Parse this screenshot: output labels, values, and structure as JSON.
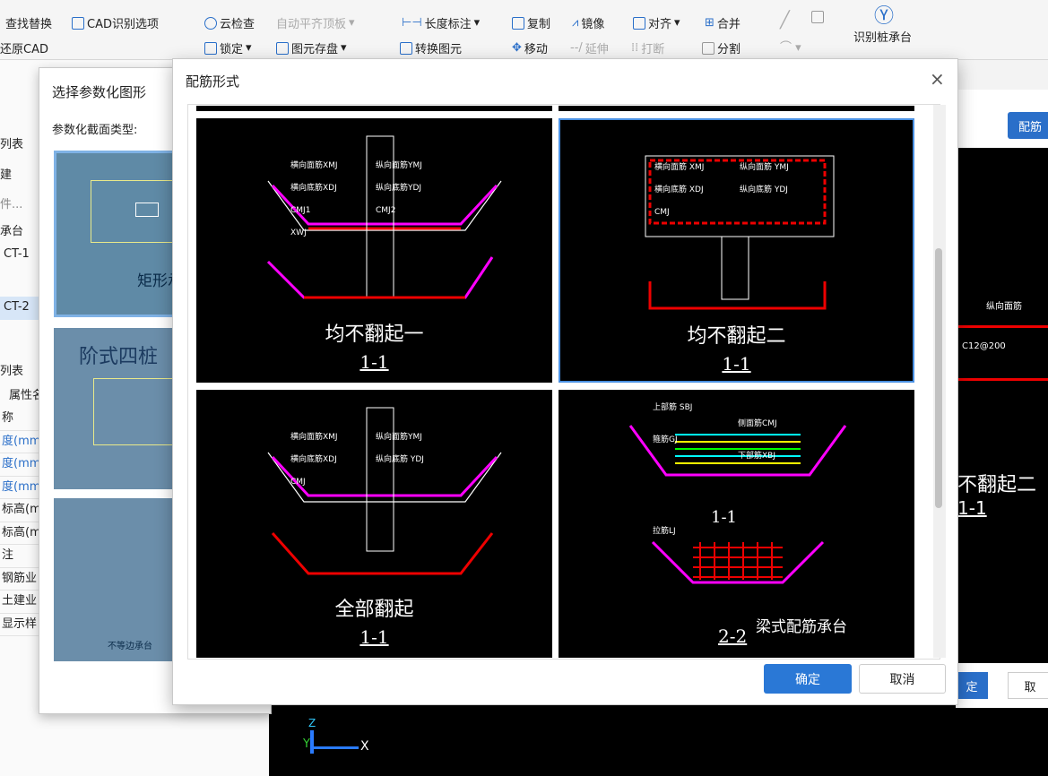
{
  "ribbon": {
    "find_replace": "查找替换",
    "cad_options": "CAD识别选项",
    "restore_cad": "还原CAD",
    "cloud_check": "云检查",
    "auto_align": "自动平齐顶板",
    "dim_length": "长度标注",
    "lock": "锁定",
    "save_element": "图元存盘",
    "convert_element": "转换图元",
    "copy": "复制",
    "mirror": "镜像",
    "align": "对齐",
    "merge": "合并",
    "move": "移动",
    "extend": "延伸",
    "break": "打断",
    "split": "分割",
    "recognize_cap": "识别桩承台"
  },
  "left": {
    "tab_list": "列表",
    "new": "建",
    "search_ph": "件...",
    "tree_cap": "承台",
    "ct1": "CT-1",
    "ct2": "CT-2",
    "tab_list2": "列表",
    "attr_header": "属性名",
    "rows": [
      "称",
      "度(mm",
      "度(mm",
      "度(mm",
      "标高(m",
      "标高(m",
      "注",
      "钢筋业",
      "土建业",
      "显示样"
    ]
  },
  "param_dialog": {
    "title": "选择参数化图形",
    "type_label": "参数化截面类型:",
    "thumb1": "矩形承台",
    "thumb2": "阶式四桩",
    "thumb3": "不等边承台"
  },
  "rebar_dialog": {
    "title": "配筋形式",
    "ok": "确定",
    "cancel": "取消",
    "options": [
      {
        "name": "均不翻起一",
        "sec": "1-1",
        "labels": [
          "横向面筋XMJ",
          "纵向面筋YMJ",
          "横向底筋XDJ",
          "纵向底筋YDJ",
          "CMJ1",
          "CMJ2",
          "XWJ"
        ]
      },
      {
        "name": "均不翻起二",
        "sec": "1-1",
        "labels": [
          "横向面筋 XMJ",
          "纵向面筋 YMJ",
          "横向底筋 XDJ",
          "纵向底筋 YDJ",
          "CMJ"
        ]
      },
      {
        "name": "全部翻起",
        "sec": "1-1",
        "labels": [
          "横向面筋XMJ",
          "纵向面筋YMJ",
          "横向底筋XDJ",
          "纵向底筋 YDJ",
          "CMJ"
        ]
      },
      {
        "name": "梁式配筋承台",
        "sec": "2-2",
        "sec2": "1-1",
        "labels": [
          "上部筋 SBJ",
          "侧面筋CMJ",
          "箍筋GJ",
          "下部筋XBJ",
          "拉筋LJ"
        ]
      }
    ]
  },
  "right": {
    "btn": "配筋",
    "text": "不翻起二",
    "sec": "1-1",
    "rebar": "C12@200",
    "ok": "定",
    "cancel": "取"
  },
  "axis": {
    "x": "X",
    "y": "Y",
    "z": "Z"
  }
}
